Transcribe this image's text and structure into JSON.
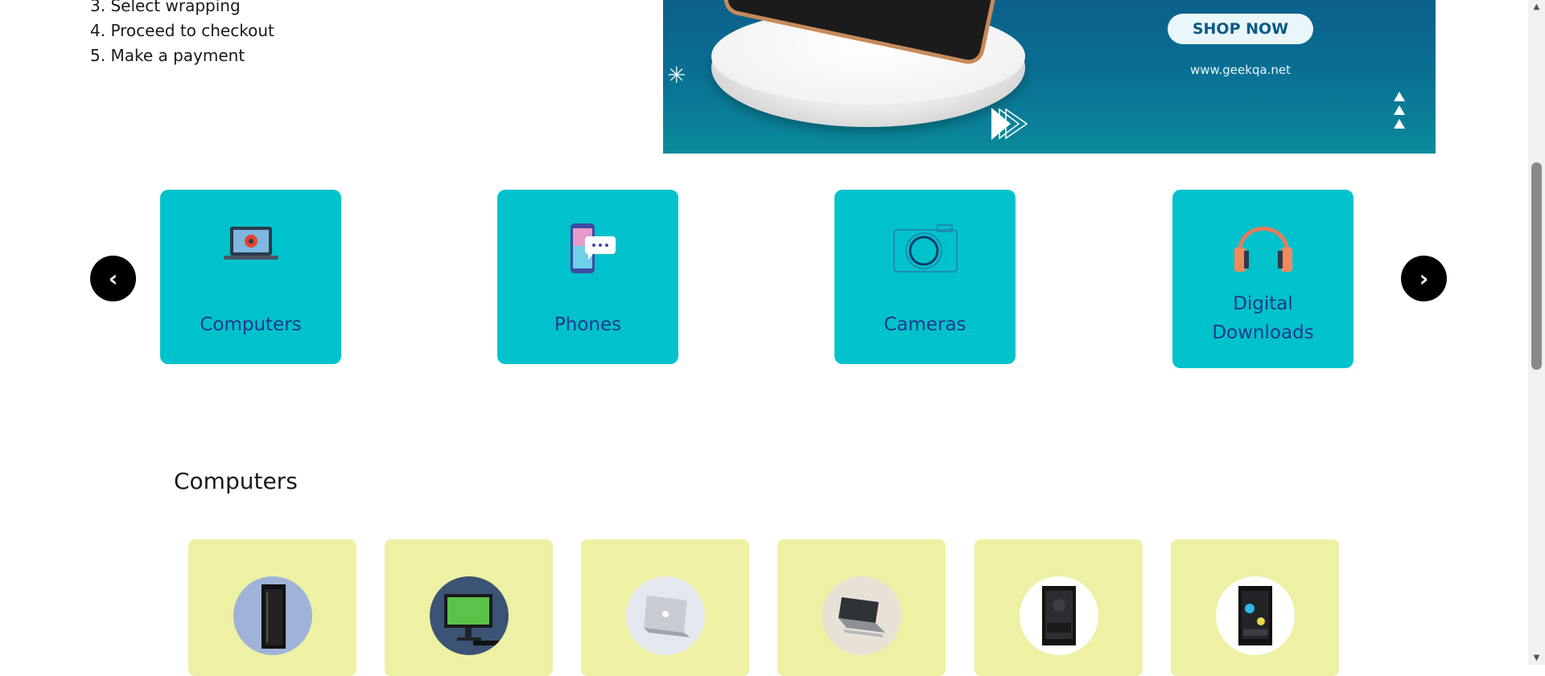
{
  "steps": [
    "3. Select wrapping",
    "4. Proceed to checkout",
    "5. Make a payment"
  ],
  "banner": {
    "button_label": "SHOP NOW",
    "url_text": "www.geekqa.net",
    "button_color": "#e9f7fb",
    "text_color": "#0a5a86"
  },
  "categories": {
    "prev_label": "‹",
    "next_label": "›",
    "items": [
      {
        "label": "Computers",
        "icon": "laptop-icon"
      },
      {
        "label": "Phones",
        "icon": "smartphone-chat-icon"
      },
      {
        "label": "Cameras",
        "icon": "camera-icon"
      },
      {
        "label": "Digital Downloads",
        "icon": "headphones-icon"
      }
    ],
    "card_color": "#00c2cc",
    "label_color": "#1f3a8a"
  },
  "section": {
    "title": "Computers"
  },
  "products": {
    "card_color": "#eef0a4",
    "items": [
      {
        "image": "server-tower-image"
      },
      {
        "image": "all-in-one-desktop-image"
      },
      {
        "image": "silver-laptop-image"
      },
      {
        "image": "laptop-stand-image"
      },
      {
        "image": "black-pc-case-image"
      },
      {
        "image": "gaming-pc-case-image"
      }
    ]
  }
}
